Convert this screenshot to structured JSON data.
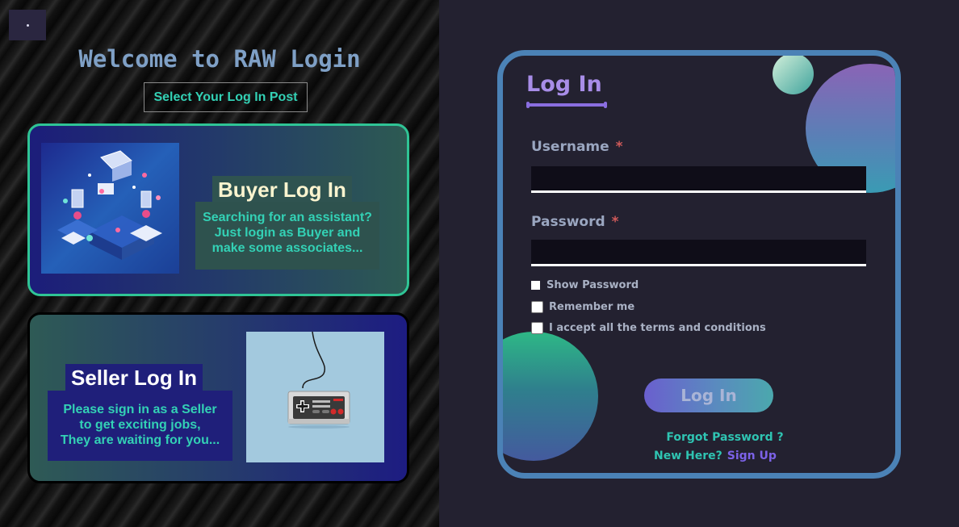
{
  "menu_button": {
    "glyph": "•"
  },
  "left": {
    "welcome_title": "Welcome to RAW Login",
    "select_post_label": "Select Your Log In Post",
    "buyer": {
      "title": "Buyer Log In",
      "description": [
        "Searching for an assistant?",
        "Just login as Buyer and",
        "make some associates..."
      ]
    },
    "seller": {
      "title": "Seller Log In",
      "description": [
        "Please sign in as a Seller",
        "to get exciting jobs,",
        "They are waiting for you..."
      ]
    }
  },
  "login": {
    "title": "Log In",
    "username_label": "Username",
    "password_label": "Password",
    "required_mark": "*",
    "username_value": "",
    "password_value": "",
    "show_password_label": "Show Password",
    "remember_label": "Remember me",
    "accept_label": "I accept all the terms and conditions",
    "button_label": "Log In",
    "forgot_label": "Forgot Password ?",
    "new_here_label": "New Here?",
    "signup_label": "Sign Up"
  },
  "colors": {
    "accent_purple": "#a88de8",
    "accent_teal": "#2fc4b2",
    "border_blue": "#4b82b6",
    "buyer_border": "#2fc495"
  },
  "icons": {
    "buyer_image": "isometric-tech-illustration",
    "seller_image": "gamepad-controller"
  }
}
